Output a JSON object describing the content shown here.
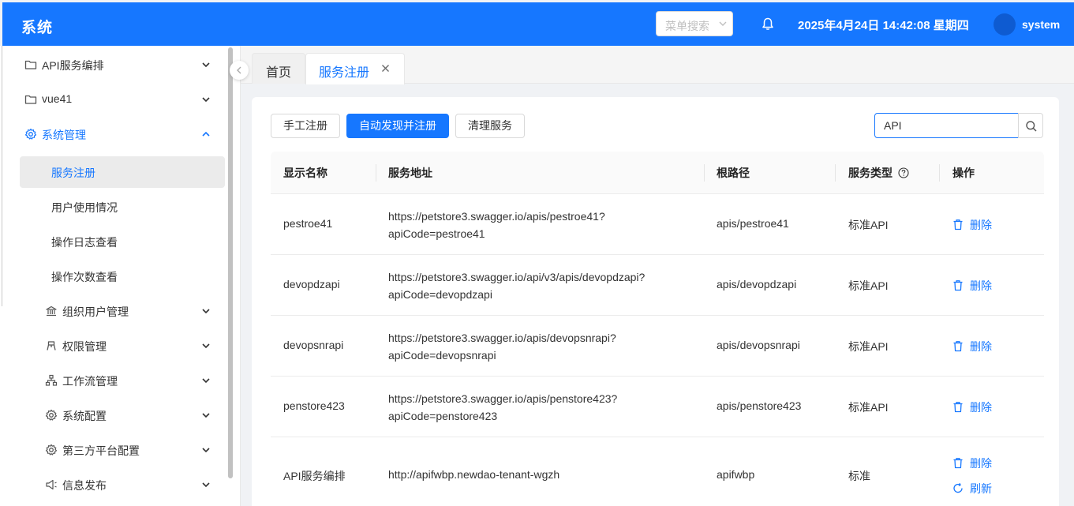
{
  "header": {
    "brand": "系统",
    "menu_search_placeholder": "菜单搜索",
    "datetime": "2025年4月24日 14:42:08 星期四",
    "username": "system",
    "colors": {
      "primary": "#1677ff"
    }
  },
  "sidebar": {
    "items": [
      {
        "label": "API服务编排",
        "icon": "folder-icon"
      },
      {
        "label": "vue41",
        "icon": "folder-icon"
      },
      {
        "label": "系统管理",
        "icon": "gear-icon",
        "expanded": true
      },
      {
        "label": "服务注册",
        "selected": true
      },
      {
        "label": "用户使用情况"
      },
      {
        "label": "操作日志查看"
      },
      {
        "label": "操作次数查看"
      },
      {
        "label": "组织用户管理",
        "icon": "bank-icon"
      },
      {
        "label": "权限管理",
        "icon": "permission-icon"
      },
      {
        "label": "工作流管理",
        "icon": "flow-icon"
      },
      {
        "label": "系统配置",
        "icon": "gear-icon"
      },
      {
        "label": "第三方平台配置",
        "icon": "gear-icon"
      },
      {
        "label": "信息发布",
        "icon": "speaker-icon"
      }
    ]
  },
  "tabs": [
    {
      "label": "首页"
    },
    {
      "label": "服务注册",
      "active": true
    }
  ],
  "toolbar": {
    "manual_register": "手工注册",
    "auto_discover": "自动发现并注册",
    "clean_services": "清理服务",
    "search_value": "API"
  },
  "table": {
    "columns": [
      "显示名称",
      "服务地址",
      "根路径",
      "服务类型",
      "操作"
    ],
    "rows": [
      {
        "name": "pestroe41",
        "address_line1": "https://petstore3.swagger.io/apis/pestroe41?",
        "address_line2": "apiCode=pestroe41",
        "root_path": "apis/pestroe41",
        "type": "标准API",
        "actions": [
          "删除"
        ]
      },
      {
        "name": "devopdzapi",
        "address_line1": "https://petstore3.swagger.io/api/v3/apis/devopdzapi?",
        "address_line2": "apiCode=devopdzapi",
        "root_path": "apis/devopdzapi",
        "type": "标准API",
        "actions": [
          "删除"
        ]
      },
      {
        "name": "devopsnrapi",
        "address_line1": "https://petstore3.swagger.io/apis/devopsnrapi?",
        "address_line2": "apiCode=devopsnrapi",
        "root_path": "apis/devopsnrapi",
        "type": "标准API",
        "actions": [
          "删除"
        ]
      },
      {
        "name": "penstore423",
        "address_line1": "https://petstore3.swagger.io/apis/penstore423?",
        "address_line2": "apiCode=penstore423",
        "root_path": "apis/penstore423",
        "type": "标准API",
        "actions": [
          "删除"
        ]
      },
      {
        "name": "API服务编排",
        "address_line1": "http://apifwbp.newdao-tenant-wgzh",
        "root_path": "apifwbp",
        "type": "标准",
        "actions": [
          "删除",
          "刷新"
        ]
      }
    ]
  }
}
